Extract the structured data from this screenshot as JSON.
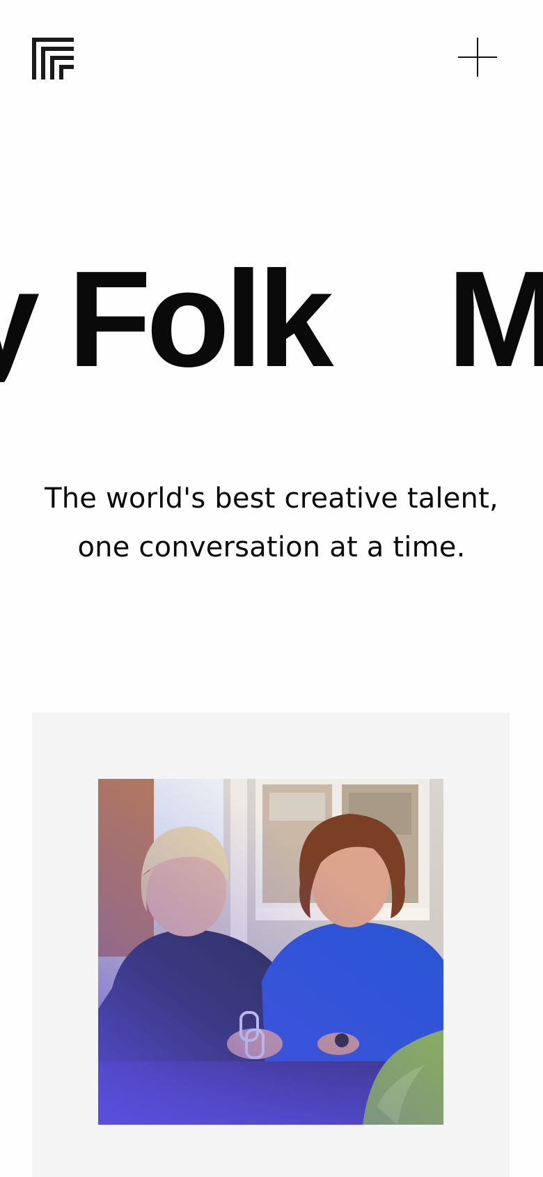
{
  "header": {
    "logo_icon": "ff-monogram-logo-icon",
    "menu_icon": "plus-icon"
  },
  "hero": {
    "marquee_words": [
      "y Folk",
      "Ma"
    ]
  },
  "tagline": {
    "line1": "The world's best creative talent,",
    "line2": "one conversation at a time."
  },
  "feature": {
    "image_icon": "two-women-portrait-image"
  },
  "colors": {
    "background": "#fefefe",
    "text": "#0a0a0a",
    "card": "#f4f4f4",
    "accent_purple": "#5a4fe0",
    "shirt_blue": "#2b55d6"
  }
}
